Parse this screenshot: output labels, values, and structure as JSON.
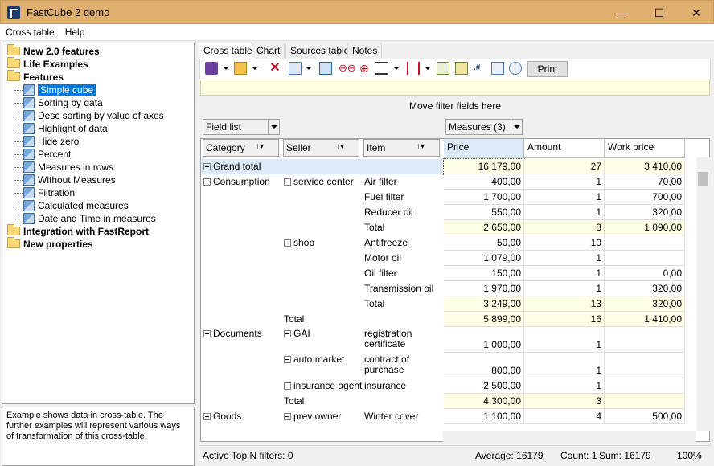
{
  "window": {
    "title": "FastCube 2 demo",
    "minimize": "—",
    "maximize": "☐",
    "close": "✕"
  },
  "menu": [
    "Cross table",
    "Help"
  ],
  "tree": {
    "folders": [
      {
        "label": "New 2.0 features"
      },
      {
        "label": "Life Examples"
      },
      {
        "label": "Features"
      }
    ],
    "features": [
      "Simple cube",
      "Sorting by data",
      "Desc sorting by value of axes",
      "Highlight of data",
      "Hide zero",
      "Percent",
      "Measures in rows",
      "Without Measures",
      "Filtration",
      "Calculated measures",
      "Date and Time in measures"
    ],
    "folders_after": [
      {
        "label": "Integration with FastReport"
      },
      {
        "label": "New properties"
      }
    ],
    "selected": "Simple cube"
  },
  "description": "Example shows data in cross-table. The further examples will represent various ways of transformation of this cross-table.",
  "tabs": [
    "Cross table",
    "Chart",
    "Sources table",
    "Notes"
  ],
  "active_tab": "Cross table",
  "toolbar": {
    "print": "Print"
  },
  "filter_hint": "Move filter fields here",
  "field_list": "Field list",
  "measures_combo": "Measures (3)",
  "row_fields": [
    "Category",
    "Seller",
    "Item"
  ],
  "measures": [
    "Price",
    "Amount",
    "Work price"
  ],
  "rows": [
    {
      "category": "Grand total",
      "seller": "",
      "item": "",
      "price": "16 179,00",
      "amount": "27",
      "work": "3 410,00",
      "kind": "grand"
    },
    {
      "category": "Consumption",
      "seller": "service center",
      "item": "Air filter",
      "price": "400,00",
      "amount": "1",
      "work": "70,00",
      "kind": "data"
    },
    {
      "category": "",
      "seller": "",
      "item": "Fuel filter",
      "price": "1 700,00",
      "amount": "1",
      "work": "700,00",
      "kind": "data"
    },
    {
      "category": "",
      "seller": "",
      "item": "Reducer oil",
      "price": "550,00",
      "amount": "1",
      "work": "320,00",
      "kind": "data"
    },
    {
      "category": "",
      "seller": "",
      "item": "Total",
      "price": "2 650,00",
      "amount": "3",
      "work": "1 090,00",
      "kind": "total"
    },
    {
      "category": "",
      "seller": "shop",
      "item": "Antifreeze",
      "price": "50,00",
      "amount": "10",
      "work": "",
      "kind": "data"
    },
    {
      "category": "",
      "seller": "",
      "item": "Motor oil",
      "price": "1 079,00",
      "amount": "1",
      "work": "",
      "kind": "data"
    },
    {
      "category": "",
      "seller": "",
      "item": "Oil filter",
      "price": "150,00",
      "amount": "1",
      "work": "0,00",
      "kind": "data"
    },
    {
      "category": "",
      "seller": "",
      "item": "Transmission oil",
      "price": "1 970,00",
      "amount": "1",
      "work": "320,00",
      "kind": "data"
    },
    {
      "category": "",
      "seller": "",
      "item": "Total",
      "price": "3 249,00",
      "amount": "13",
      "work": "320,00",
      "kind": "total"
    },
    {
      "category": "",
      "seller": "Total",
      "item": "",
      "price": "5 899,00",
      "amount": "16",
      "work": "1 410,00",
      "kind": "total"
    },
    {
      "category": "Documents",
      "seller": "GAI",
      "item": "registration certificate",
      "price": "1 000,00",
      "amount": "1",
      "work": "",
      "kind": "data2"
    },
    {
      "category": "",
      "seller": "auto market",
      "item": "contract of purchase",
      "price": "800,00",
      "amount": "1",
      "work": "",
      "kind": "data2"
    },
    {
      "category": "",
      "seller": "insurance agent",
      "item": "insurance",
      "price": "2 500,00",
      "amount": "1",
      "work": "",
      "kind": "data"
    },
    {
      "category": "",
      "seller": "Total",
      "item": "",
      "price": "4 300,00",
      "amount": "3",
      "work": "",
      "kind": "total"
    },
    {
      "category": "Goods",
      "seller": "prev owner",
      "item": "Winter cover",
      "price": "1 100,00",
      "amount": "4",
      "work": "500,00",
      "kind": "data"
    }
  ],
  "status": {
    "filters": "Active Top N filters: 0",
    "average": "Average: 16179",
    "count": "Count: 1",
    "sum": "Sum: 16179",
    "zoom": "100%"
  }
}
